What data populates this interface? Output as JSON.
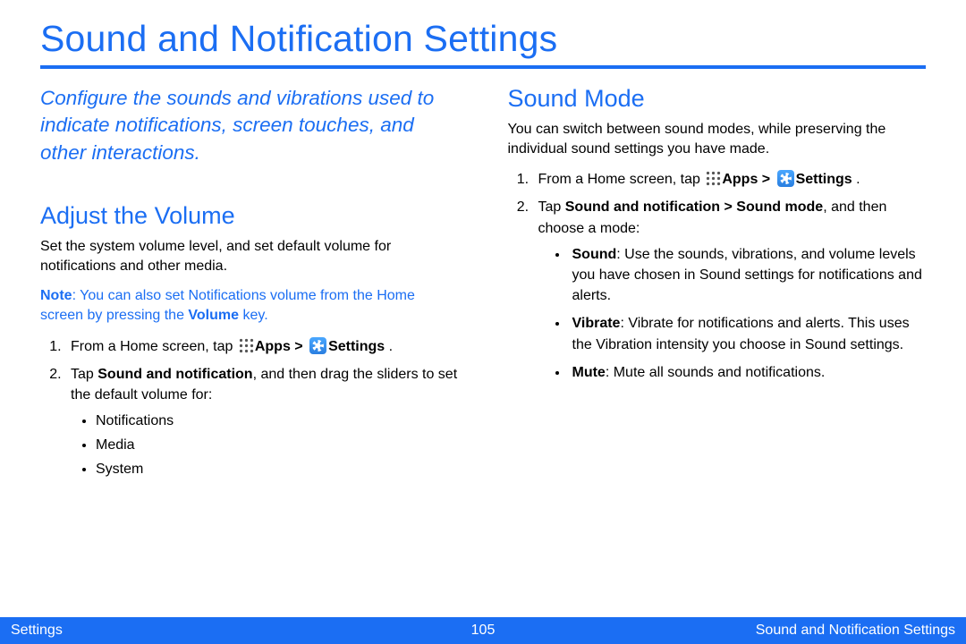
{
  "title": "Sound and Notification Settings",
  "intro": "Configure the sounds and vibrations used to indicate notifications, screen touches, and other interactions.",
  "left": {
    "h2": "Adjust the Volume",
    "p1": "Set the system volume level, and set default volume for notifications and other media.",
    "note_prefix": "Note",
    "note_body": ": You can also set Notifications volume from the Home screen by pressing the ",
    "note_bold": "Volume",
    "note_tail": " key.",
    "step1_a": "From a Home screen, tap ",
    "step1_apps": "Apps > ",
    "step1_settings": "Settings",
    "step1_tail": " .",
    "step2_a": "Tap ",
    "step2_bold": "Sound and notification",
    "step2_b": ", and then drag the sliders to set the default volume for:",
    "bullets": [
      "Notifications",
      "Media",
      "System"
    ]
  },
  "right": {
    "h2": "Sound Mode",
    "p1": "You can switch between sound modes, while preserving the individual sound settings you have made.",
    "step1_a": "From a Home screen, tap ",
    "step1_apps": "Apps > ",
    "step1_settings": "Settings",
    "step1_tail": " .",
    "step2_a": "Tap ",
    "step2_bold": "Sound and notification > Sound mode",
    "step2_b": ", and then choose a mode:",
    "modes": {
      "sound_label": "Sound",
      "sound_text": ": Use the sounds, vibrations, and volume levels you have chosen in Sound settings for notifications and alerts.",
      "vibrate_label": "Vibrate",
      "vibrate_text": ": Vibrate for notifications and alerts. This uses the Vibration intensity you choose in Sound settings.",
      "mute_label": "Mute",
      "mute_text": ": Mute all sounds and notifications."
    }
  },
  "footer": {
    "left": "Settings",
    "page": "105",
    "right": "Sound and Notification Settings"
  }
}
